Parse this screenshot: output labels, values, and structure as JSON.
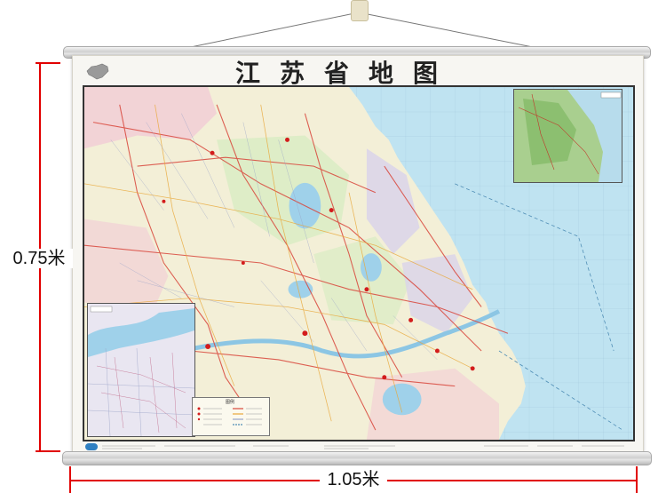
{
  "map": {
    "title": "江苏省地图",
    "legend_title": "图例"
  },
  "dimensions": {
    "height_label": "0.75米",
    "width_label": "1.05米"
  },
  "colors": {
    "sea": "#bfe3f1",
    "land": "#f3efd7",
    "province_pink": "#f2c9d5",
    "province_green": "#d8ecc3",
    "province_purple": "#d9d3ea",
    "road": "#d9463b",
    "marker": "#e10000"
  }
}
